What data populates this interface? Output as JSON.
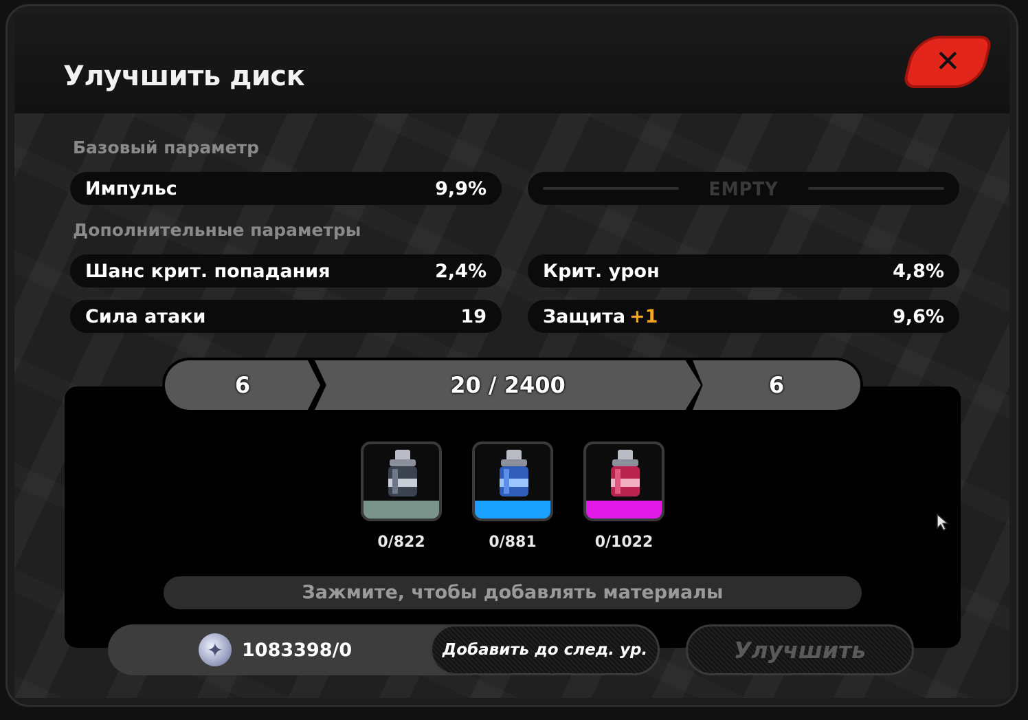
{
  "window": {
    "title": "Улучшить диск"
  },
  "base_section": {
    "label": "Базовый параметр",
    "main_stat": {
      "name": "Импульс",
      "value": "9,9%"
    },
    "empty_slot": {
      "label": "EMPTY"
    }
  },
  "extra_section": {
    "label": "Дополнительные параметры",
    "stats": [
      {
        "name": "Шанс крит. попадания",
        "value": "2,4%",
        "bonus": ""
      },
      {
        "name": "Крит. урон",
        "value": "4,8%",
        "bonus": ""
      },
      {
        "name": "Сила атаки",
        "value": "19",
        "bonus": ""
      },
      {
        "name": "Защита",
        "value": "9,6%",
        "bonus": "+1"
      }
    ]
  },
  "level": {
    "current": "6",
    "exp": "20 / 2400",
    "next": "6"
  },
  "materials": [
    {
      "icon": "canister-gray-icon",
      "count": "0/822",
      "color": "#7a948c"
    },
    {
      "icon": "canister-blue-icon",
      "count": "0/881",
      "color": "#1aa0ff"
    },
    {
      "icon": "canister-purple-icon",
      "count": "0/1022",
      "color": "#e21ae8"
    }
  ],
  "hint": "Зажмите, чтобы добавлять материалы",
  "currency": {
    "icon": "dennies-coin-icon",
    "value": "1083398/0"
  },
  "buttons": {
    "add_to_next": "Добавить до след. ур.",
    "upgrade": "Улучшить"
  }
}
